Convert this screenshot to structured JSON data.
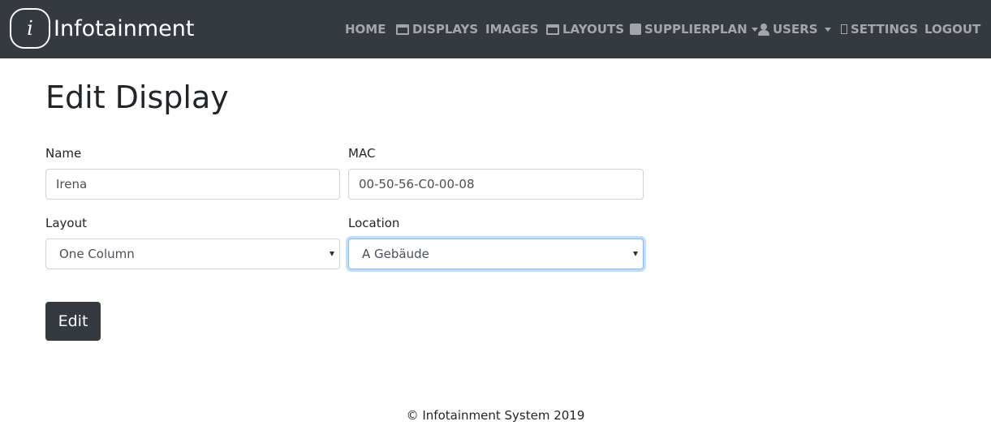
{
  "brand": {
    "logo_glyph": "i",
    "name": "Infotainment"
  },
  "nav": {
    "home": "HOME",
    "displays": "DISPLAYS",
    "images": "IMAGES",
    "layouts": "LAYOUTS",
    "supplierplan": "SUPPLIERPLAN",
    "users": "USERS",
    "settings": "SETTINGS",
    "logout": "LOGOUT"
  },
  "page": {
    "title": "Edit Display"
  },
  "form": {
    "name_label": "Name",
    "name_value": "Irena",
    "mac_label": "MAC",
    "mac_value": "00-50-56-C0-00-08",
    "layout_label": "Layout",
    "layout_value": "One Column",
    "location_label": "Location",
    "location_value": "A Gebäude",
    "submit_label": "Edit"
  },
  "footer": {
    "text": "© Infotainment System 2019"
  },
  "colors": {
    "navbar": "#343a40",
    "button": "#343a40",
    "focus": "#80bdff"
  }
}
